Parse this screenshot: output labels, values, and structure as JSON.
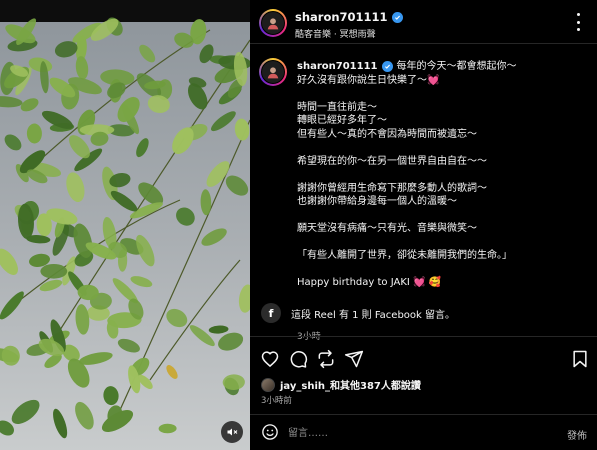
{
  "header": {
    "username": "sharon701111",
    "audio": "酷客音樂 · 冥想雨聲"
  },
  "caption": {
    "username": "sharon701111",
    "lines": [
      "每年的今天～都會想起你～",
      "好久沒有跟你說生日快樂了～💓",
      "",
      "時間一直往前走～",
      "轉眼已經好多年了～",
      "但有些人～真的不會因為時間而被遺忘～",
      "",
      "希望現在的你～在另一個世界自由自在～～",
      "",
      "謝謝你曾經用生命寫下那麼多動人的歌詞～",
      "也謝謝你帶給身邊每一個人的溫暖～",
      "",
      "願天堂沒有病痛～只有光、音樂與微笑～",
      "",
      "「有些人離開了世界，卻從未離開我們的生命。」",
      "",
      "Happy birthday to JAKI 💓 🥰"
    ],
    "time": "3小時"
  },
  "facebook": {
    "text": "這段 Reel 有 1 則 Facebook 留言。",
    "icon": "f"
  },
  "likes": {
    "text": "jay_shih_和其他387人都說讚"
  },
  "post_time": "3小時前",
  "comment": {
    "placeholder": "留言……",
    "post_label": "發佈"
  },
  "icons": {
    "like": "heart-icon",
    "comment": "comment-icon",
    "share": "repost-icon",
    "send": "send-icon",
    "save": "bookmark-icon",
    "mute": "speaker-muted-icon",
    "emoji": "emoji-icon",
    "more": "more-icon"
  },
  "colors": {
    "verified": "#3897f0",
    "background": "#000000",
    "muted_text": "#a8a8a8"
  }
}
